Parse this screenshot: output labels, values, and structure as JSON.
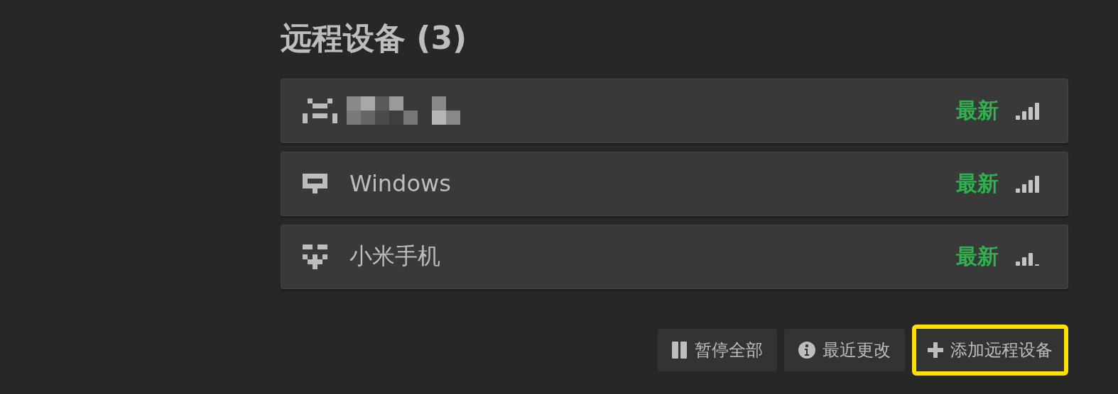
{
  "section": {
    "title": "远程设备 (3)"
  },
  "devices": [
    {
      "redacted": true,
      "status": "最新"
    },
    {
      "name": "Windows",
      "redacted": false,
      "status": "最新"
    },
    {
      "name": "小米手机",
      "redacted": false,
      "status": "最新"
    }
  ],
  "buttons": [
    {
      "kind": "pause",
      "label": "暂停全部",
      "highlighted": false
    },
    {
      "kind": "info",
      "label": "最近更改",
      "highlighted": false
    },
    {
      "kind": "add",
      "label": "添加远程设备",
      "highlighted": true
    }
  ]
}
